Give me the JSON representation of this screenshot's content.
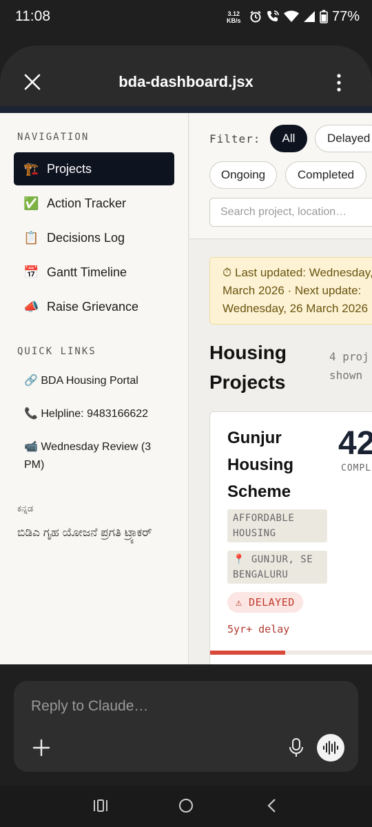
{
  "status_bar": {
    "time": "11:08",
    "net_speed_value": "3.12",
    "net_speed_unit": "KB/s",
    "battery": "77%"
  },
  "header": {
    "title": "bda-dashboard.jsx"
  },
  "sidebar": {
    "nav_heading": "NAVIGATION",
    "nav_items": [
      {
        "emoji": "🏗️",
        "label": "Projects",
        "active": true
      },
      {
        "emoji": "✅",
        "label": "Action Tracker"
      },
      {
        "emoji": "📋",
        "label": "Decisions Log"
      },
      {
        "emoji": "📅",
        "label": "Gantt Timeline"
      },
      {
        "emoji": "📣",
        "label": "Raise Grievance"
      }
    ],
    "quick_links_heading": "QUICK LINKS",
    "quick_links": [
      {
        "label": "🔗 BDA Housing Portal"
      },
      {
        "label": "📞 Helpline: 9483166622"
      },
      {
        "label": "📹 Wednesday Review (3 PM)"
      }
    ],
    "kannada_heading": "ಕನ್ನಡ",
    "kannada_text": "ಬಿಡಿಎ ಗೃಹ ಯೋಜನೆ ಪ್ರಗತಿ ಟ್ರ್ಯಾಕರ್"
  },
  "filters": {
    "label": "Filter:",
    "chips": [
      "All",
      "Delayed",
      "Ongoing",
      "Completed"
    ],
    "active": "All",
    "search_placeholder": "Search project, location…"
  },
  "notice": {
    "text": "⏱ Last updated: Wednesday, March 2026 · Next update: Wednesday, 26 March 2026"
  },
  "section": {
    "title": "Housing Projects",
    "count": "4 proj shown"
  },
  "project_card": {
    "name": "Gunjur Housing Scheme",
    "percent": "42",
    "percent_label": "COMPL",
    "category": "AFFORDABLE HOUSING",
    "location": "📍 GUNJUR, SE BENGALURU",
    "status": "⚠ DELAYED",
    "delay": "5yr+ delay",
    "progress": 0.42,
    "progress_color": "#d9493a"
  },
  "reply": {
    "placeholder": "Reply to Claude…"
  }
}
